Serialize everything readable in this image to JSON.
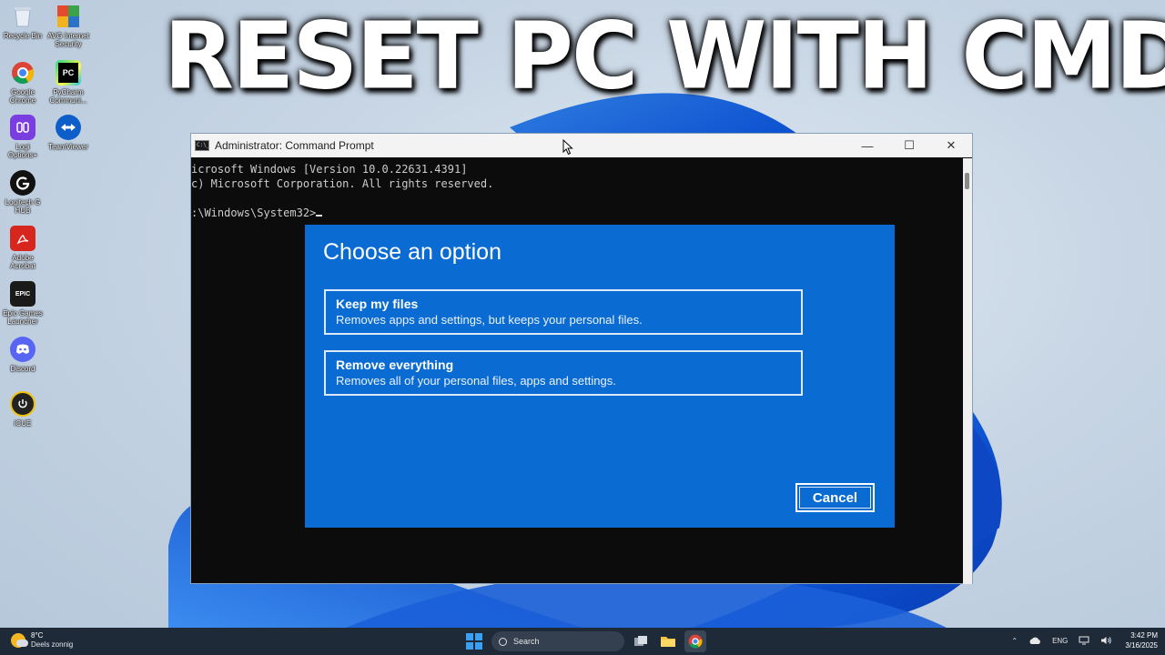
{
  "headline": "RESET PC WITH CMD",
  "desktop_icons": [
    {
      "label": "Recycle Bin",
      "icon": "recycle-bin-icon"
    },
    {
      "label": "AVG Internet\nSecurity",
      "icon": "avg-icon"
    },
    {
      "label": "Google\nChrome",
      "icon": "chrome-icon"
    },
    {
      "label": "PyCharm\nCommuni...",
      "icon": "pycharm-icon",
      "glyph": "PC"
    },
    {
      "label": "Logi\nOptions+",
      "icon": "logi-options-icon"
    },
    {
      "label": "TeamViewer",
      "icon": "teamviewer-icon"
    },
    {
      "label": "Logitech G\nHUB",
      "icon": "logitech-g-hub-icon"
    },
    {
      "label": "Adobe\nAcrobat",
      "icon": "adobe-acrobat-icon"
    },
    {
      "label": "Epic Games\nLauncher",
      "icon": "epic-games-icon",
      "glyph": "EPIC"
    },
    {
      "label": "Discord",
      "icon": "discord-icon"
    },
    {
      "label": "iCUE",
      "icon": "icue-icon"
    }
  ],
  "cmd": {
    "title": "Administrator: Command Prompt",
    "icon_text": "C:\\_",
    "lines": [
      "icrosoft Windows [Version 10.0.22631.4391]",
      "c) Microsoft Corporation. All rights reserved.",
      "",
      ":\\Windows\\System32>"
    ],
    "controls": {
      "minimize": "—",
      "maximize": "☐",
      "close": "✕"
    }
  },
  "reset_dialog": {
    "title": "Choose an option",
    "options": [
      {
        "heading": "Keep my files",
        "description": "Removes apps and settings, but keeps your personal files."
      },
      {
        "heading": "Remove everything",
        "description": "Removes all of your personal files, apps and settings."
      }
    ],
    "cancel_label": "Cancel",
    "accent_color": "#0a6cd3"
  },
  "taskbar": {
    "weather_temp": "8°C",
    "weather_desc": "Deels zonnig",
    "search_placeholder": "Search",
    "tray_chevron": "⌃",
    "language": "ENG",
    "time": "3:42 PM",
    "date": "3/16/2025"
  }
}
